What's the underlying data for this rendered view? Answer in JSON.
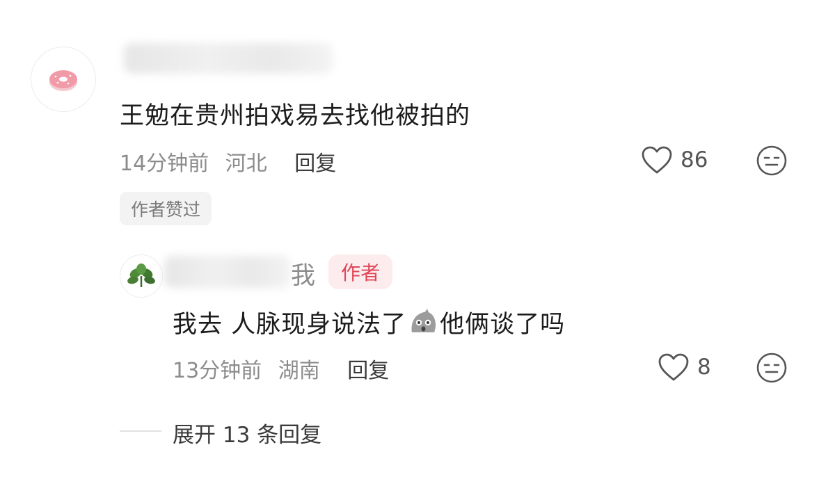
{
  "comment": {
    "content": "王勉在贵州拍戏易去找他被拍的",
    "time": "14分钟前",
    "location": "河北",
    "reply_label": "回复",
    "likes": "86",
    "liked_badge": "作者赞过"
  },
  "reply": {
    "me_label": "我",
    "author_badge": "作者",
    "content_before": "我去 人脉现身说法了",
    "content_after": "他俩谈了吗",
    "emoji": "shocked-face-emoji",
    "time": "13分钟前",
    "location": "湖南",
    "reply_label": "回复",
    "likes": "8"
  },
  "expand": {
    "label": "展开 13 条回复"
  },
  "colors": {
    "author_red": "#e04657",
    "author_bg": "#fdecee",
    "meta_gray": "#8c8c8c"
  }
}
